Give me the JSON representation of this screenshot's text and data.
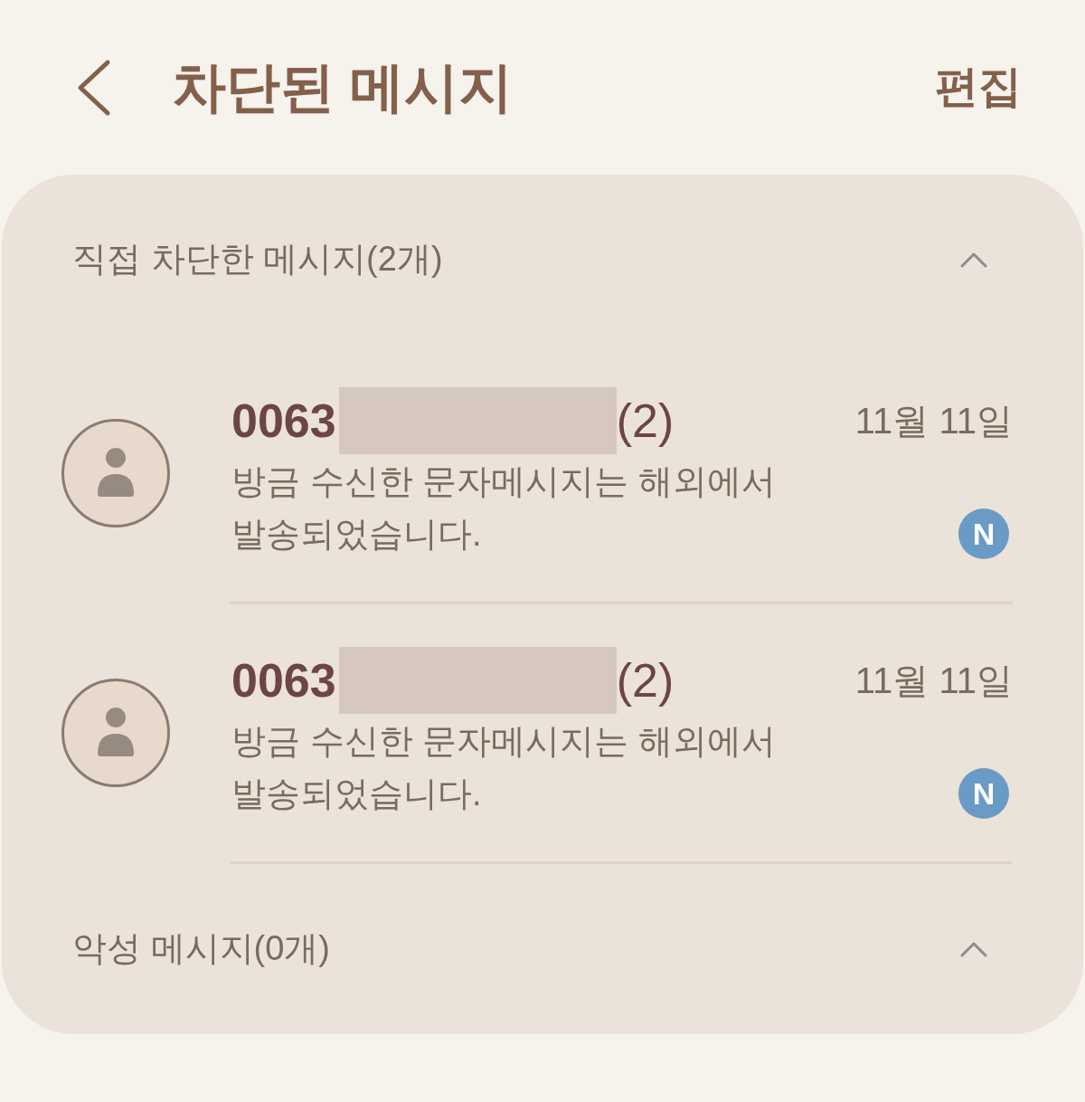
{
  "header": {
    "title": "차단된 메시지",
    "edit": "편집"
  },
  "sections": [
    {
      "title": "직접 차단한 메시지(2개)",
      "expanded": true,
      "messages": [
        {
          "sender": "0063",
          "redacted": true,
          "count": "(2)",
          "date": "11월 11일",
          "preview": "방금 수신한 문자메시지는 해외에서 발송되었습니다.",
          "badge": "N"
        },
        {
          "sender": "0063",
          "redacted": true,
          "count": "(2)",
          "date": "11월 11일",
          "preview": "방금 수신한 문자메시지는 해외에서 발송되었습니다.",
          "badge": "N"
        }
      ]
    },
    {
      "title": "악성 메시지(0개)",
      "expanded": true
    }
  ]
}
